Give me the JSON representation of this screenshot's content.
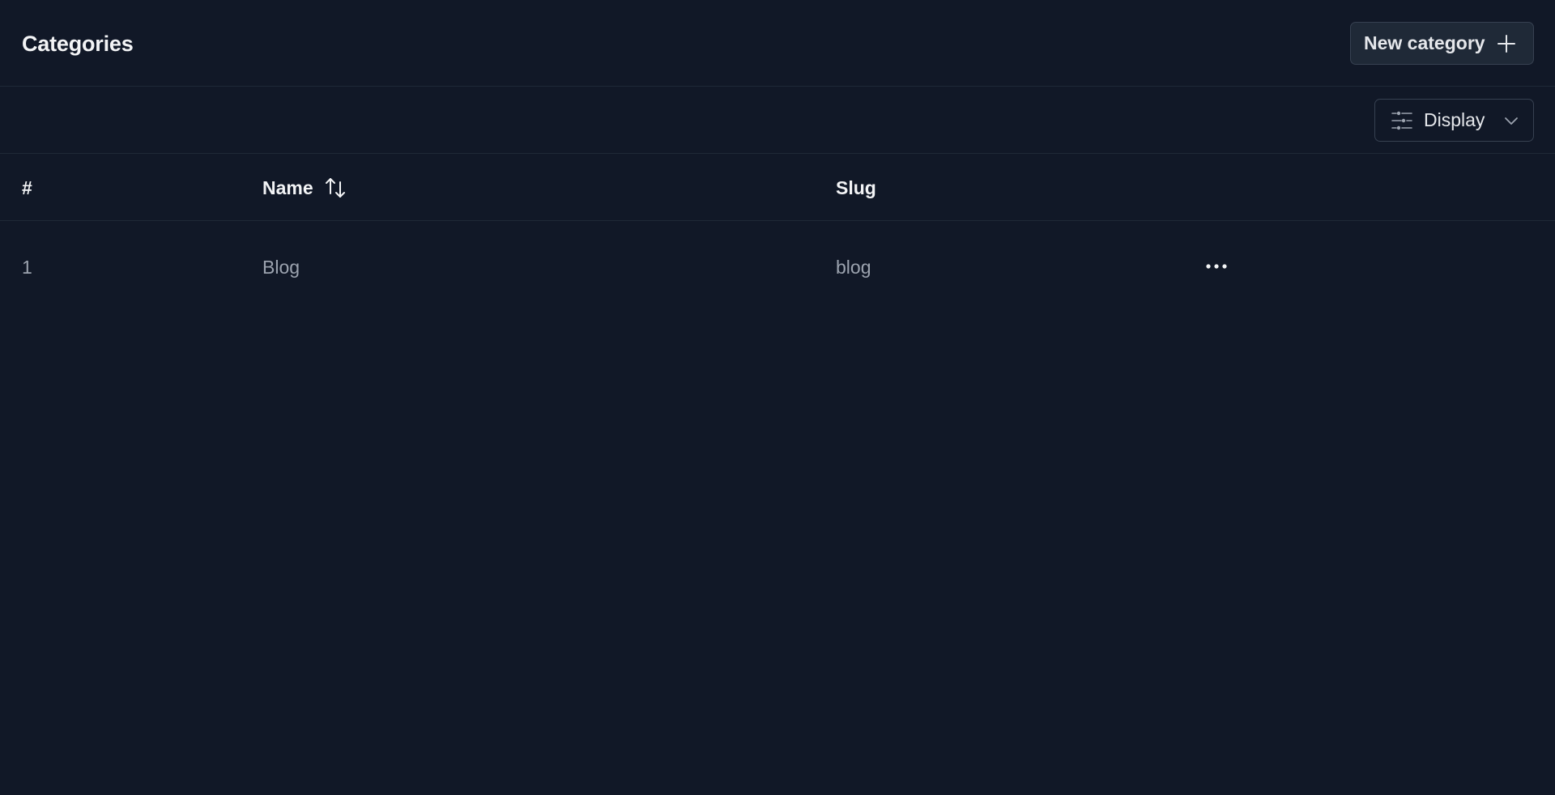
{
  "header": {
    "title": "Categories",
    "new_button_label": "New category",
    "new_button_icon": "plus-icon"
  },
  "toolbar": {
    "display_label": "Display",
    "display_icon": "sliders-icon",
    "display_chevron": "chevron-down-icon"
  },
  "table": {
    "columns": [
      {
        "label": "#"
      },
      {
        "label": "Name",
        "sortable": true,
        "sort_icon": "sort-arrows-icon"
      },
      {
        "label": "Slug"
      }
    ],
    "rows": [
      {
        "id": "1",
        "name": "Blog",
        "slug": "blog",
        "actions_icon": "more-horizontal-icon"
      }
    ]
  },
  "colors": {
    "background": "#111827",
    "border": "#1f2937",
    "button_bg": "#1f2937",
    "button_border": "#374151",
    "text_primary": "#f3f4f6",
    "text_muted": "#9ca3af"
  }
}
